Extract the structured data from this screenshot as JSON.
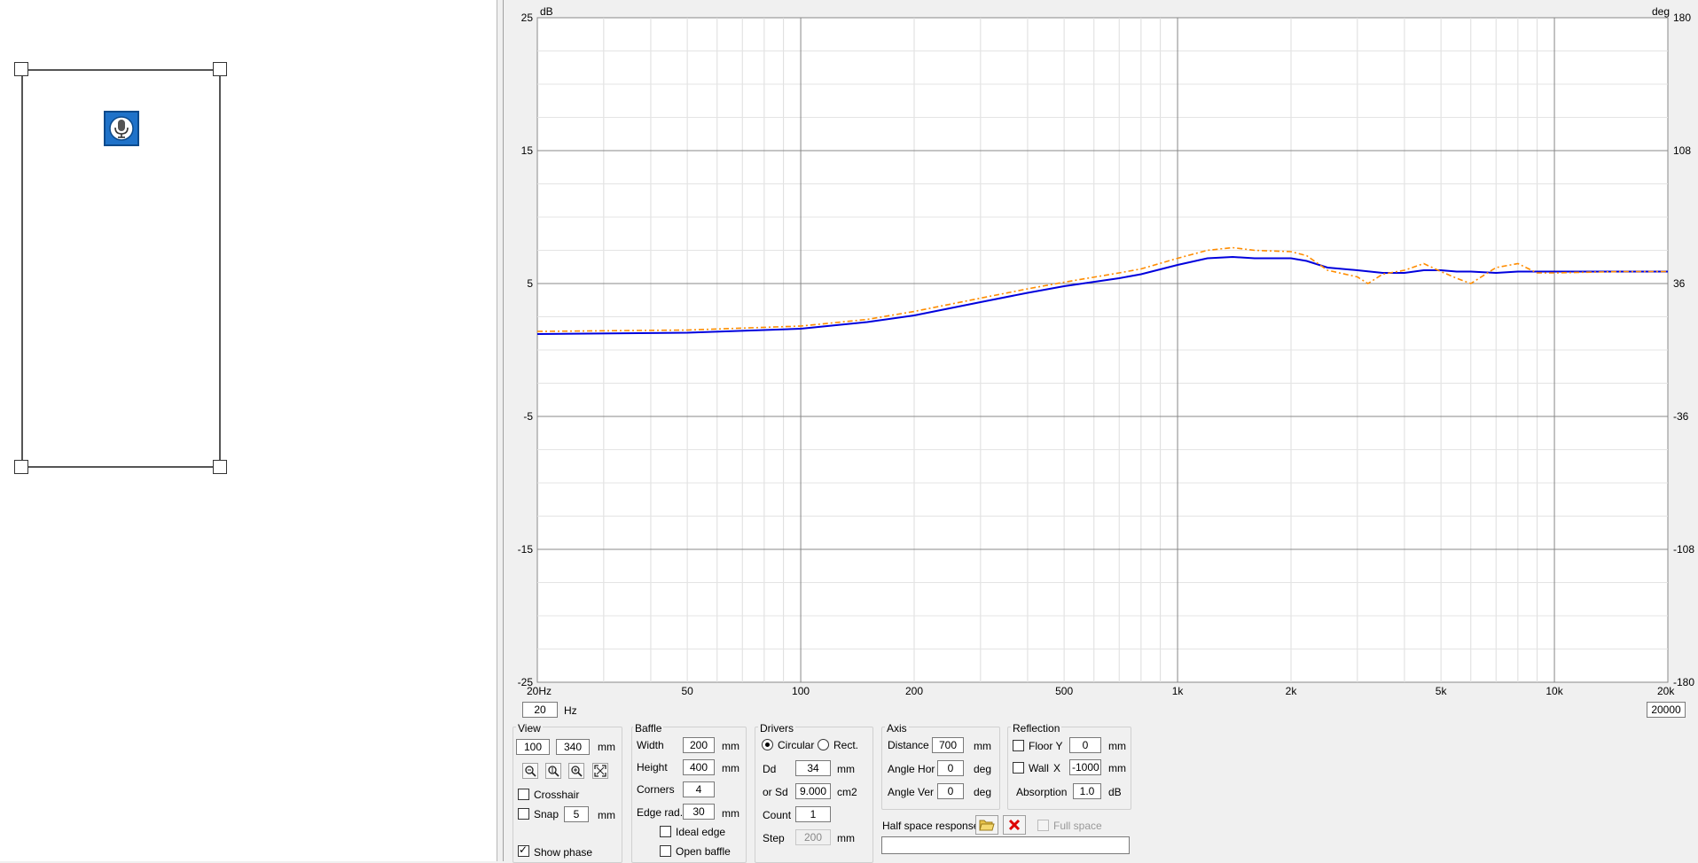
{
  "chart_data": {
    "type": "line",
    "xscale": "log",
    "xlim": [
      20,
      20000
    ],
    "ylim": [
      -25,
      25
    ],
    "y2lim": [
      -180,
      180
    ],
    "yunit": "dB",
    "y2unit": "deg",
    "x_ticks": [
      {
        "value": 20,
        "label": "20Hz"
      },
      {
        "value": 50,
        "label": "50"
      },
      {
        "value": 100,
        "label": "100"
      },
      {
        "value": 200,
        "label": "200"
      },
      {
        "value": 500,
        "label": "500"
      },
      {
        "value": 1000,
        "label": "1k"
      },
      {
        "value": 2000,
        "label": "2k"
      },
      {
        "value": 5000,
        "label": "5k"
      },
      {
        "value": 10000,
        "label": "10k"
      },
      {
        "value": 20000,
        "label": "20k"
      }
    ],
    "y_ticks": [
      {
        "value": 25,
        "label": "25"
      },
      {
        "value": 15,
        "label": "15"
      },
      {
        "value": 5,
        "label": "5"
      },
      {
        "value": -5,
        "label": "-5"
      },
      {
        "value": -15,
        "label": "-15"
      },
      {
        "value": -25,
        "label": "-25"
      }
    ],
    "y2_ticks": [
      {
        "value": 180,
        "label": "180"
      },
      {
        "value": 108,
        "label": "108"
      },
      {
        "value": 36,
        "label": "36"
      },
      {
        "value": -36,
        "label": "-36"
      },
      {
        "value": -108,
        "label": "-108"
      },
      {
        "value": -180,
        "label": "-180"
      }
    ],
    "grid": true,
    "series": [
      {
        "color": "#0000dd",
        "style": "solid",
        "x": [
          20,
          50,
          100,
          150,
          200,
          300,
          400,
          500,
          700,
          800,
          1000,
          1200,
          1400,
          1600,
          2000,
          2200,
          2500,
          3000,
          3500,
          4000,
          4500,
          5000,
          5500,
          6000,
          7000,
          8000,
          10000,
          15000,
          20000
        ],
        "y": [
          1.2,
          1.3,
          1.6,
          2.1,
          2.6,
          3.6,
          4.3,
          4.8,
          5.4,
          5.7,
          6.4,
          6.9,
          7.0,
          6.9,
          6.9,
          6.7,
          6.2,
          6.0,
          5.8,
          5.8,
          6.0,
          6.0,
          5.9,
          5.9,
          5.8,
          5.9,
          5.9,
          5.9,
          5.9
        ]
      },
      {
        "color": "#ff8c00",
        "style": "dashdot",
        "x": [
          20,
          50,
          100,
          150,
          200,
          300,
          400,
          500,
          700,
          800,
          1000,
          1200,
          1400,
          1600,
          2000,
          2200,
          2500,
          3000,
          3200,
          3500,
          4000,
          4500,
          5000,
          5500,
          6000,
          7000,
          8000,
          9000,
          10000,
          15000,
          20000
        ],
        "y": [
          1.4,
          1.5,
          1.8,
          2.3,
          2.9,
          3.9,
          4.6,
          5.1,
          5.8,
          6.1,
          6.9,
          7.5,
          7.7,
          7.5,
          7.4,
          7.1,
          6.0,
          5.5,
          5.0,
          5.7,
          6.0,
          6.5,
          5.9,
          5.4,
          5.0,
          6.2,
          6.5,
          5.8,
          5.8,
          5.9,
          5.9
        ]
      }
    ]
  },
  "freq_low": "20",
  "freq_low_unit": "Hz",
  "freq_high": "20000",
  "view": {
    "title": "View",
    "x": "100",
    "y": "340",
    "unit": "mm",
    "crosshair_label": "Crosshair",
    "crosshair_checked": false,
    "snap_label": "Snap",
    "snap_value": "5",
    "snap_unit": "mm",
    "show_phase_label": "Show phase",
    "show_phase_checked": true
  },
  "baffle": {
    "title": "Baffle",
    "width_label": "Width",
    "width": "200",
    "width_unit": "mm",
    "height_label": "Height",
    "height": "400",
    "height_unit": "mm",
    "corners_label": "Corners",
    "corners": "4",
    "edge_label": "Edge rad.",
    "edge": "30",
    "edge_unit": "mm",
    "ideal_edge_label": "Ideal edge",
    "open_baffle_label": "Open baffle"
  },
  "drivers": {
    "title": "Drivers",
    "circular_label": "Circular",
    "rect_label": "Rect.",
    "dd_label": "Dd",
    "dd": "34",
    "dd_unit": "mm",
    "sd_label": "or Sd",
    "sd": "9.000",
    "sd_unit": "cm2",
    "count_label": "Count",
    "count": "1",
    "step_label": "Step",
    "step": "200",
    "step_unit": "mm"
  },
  "axis": {
    "title": "Axis",
    "distance_label": "Distance",
    "distance": "700",
    "distance_unit": "mm",
    "angle_hor_label": "Angle Hor",
    "angle_hor": "0",
    "angle_hor_unit": "deg",
    "angle_ver_label": "Angle Ver",
    "angle_ver": "0",
    "angle_ver_unit": "deg"
  },
  "reflection": {
    "title": "Reflection",
    "floor_label": "Floor Y",
    "floor": "0",
    "floor_unit": "mm",
    "wall_label": "Wall",
    "wall_axis": "X",
    "wall": "-1000",
    "wall_unit": "mm",
    "absorption_label": "Absorption",
    "absorption": "1.0",
    "absorption_unit": "dB"
  },
  "half_space": {
    "label": "Half space response",
    "full_space_label": "Full space",
    "path": ""
  },
  "colors": {
    "series1": "#0000dd",
    "series2": "#ff8c00",
    "mic": "#1f72c9"
  },
  "icons": [
    "microphone-icon",
    "zoom-out-icon",
    "zoom-fit-height-icon",
    "zoom-in-icon",
    "zoom-extents-icon",
    "folder-open-icon",
    "delete-icon"
  ]
}
